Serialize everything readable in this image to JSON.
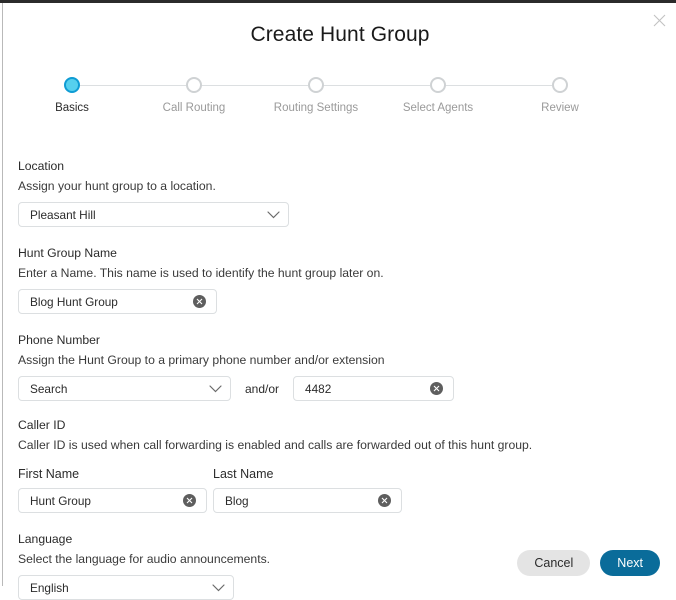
{
  "window": {
    "title": "Create Hunt Group",
    "close_icon": "close-icon"
  },
  "stepper": {
    "steps": [
      {
        "label": "Basics",
        "state": "active"
      },
      {
        "label": "Call Routing",
        "state": "inactive"
      },
      {
        "label": "Routing Settings",
        "state": "inactive"
      },
      {
        "label": "Select Agents",
        "state": "inactive"
      },
      {
        "label": "Review",
        "state": "inactive"
      }
    ],
    "active_dot_fill": "#56d0ee",
    "active_dot_ring": "#0f9cd4",
    "inactive_dot_ring": "#cfd2d4",
    "connector_color": "#dcdfe1"
  },
  "form": {
    "location": {
      "label": "Location",
      "help": "Assign your hunt group to a location.",
      "value": "Pleasant Hill",
      "chevron_icon": "chevron-down-icon"
    },
    "hunt_group_name": {
      "label": "Hunt Group Name",
      "help": "Enter a Name. This name is used to identify the hunt group later on.",
      "value": "Blog Hunt Group",
      "clear_icon": "clear-circle-icon"
    },
    "phone_number": {
      "label": "Phone Number",
      "help": "Assign the Hunt Group to a primary phone number and/or extension",
      "search_value": "Search",
      "search_chevron_icon": "chevron-down-icon",
      "separator": "and/or",
      "extension_value": "4482",
      "extension_clear_icon": "clear-circle-icon"
    },
    "caller_id": {
      "label": "Caller ID",
      "help": "Caller ID is used when call forwarding is enabled and calls are forwarded out of this hunt group.",
      "first_name_label": "First Name",
      "first_name_value": "Hunt Group",
      "first_name_clear_icon": "clear-circle-icon",
      "last_name_label": "Last Name",
      "last_name_value": "Blog",
      "last_name_clear_icon": "clear-circle-icon"
    },
    "language": {
      "label": "Language",
      "help": "Select the language for audio announcements.",
      "value": "English",
      "chevron_icon": "chevron-down-icon"
    }
  },
  "footer": {
    "cancel_label": "Cancel",
    "next_label": "Next",
    "next_color": "#0a6c9a",
    "cancel_color": "#e4e4e4"
  }
}
